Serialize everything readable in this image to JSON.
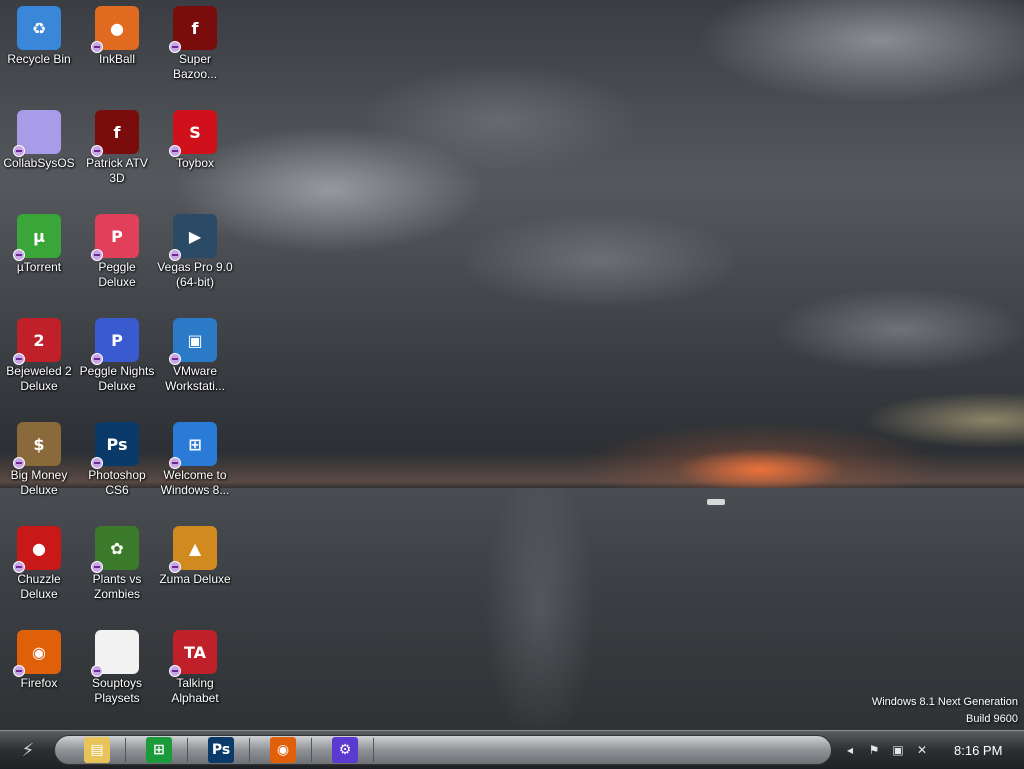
{
  "desktop": {
    "icons": [
      {
        "label": "Recycle Bin",
        "icon": "recycle-bin-icon",
        "glyph": "♻",
        "bg": "#3a86d8"
      },
      {
        "label": "InkBall",
        "icon": "inkball-icon",
        "glyph": "●",
        "bg": "#e06a20"
      },
      {
        "label": "Super Bazoo...",
        "icon": "flash-icon",
        "glyph": "f",
        "bg": "#7a0c0c"
      },
      {
        "label": "CollabSysOS",
        "icon": "collabsysos-icon",
        "glyph": "",
        "bg": "#a89ce8"
      },
      {
        "label": "Patrick ATV 3D",
        "icon": "flash-icon",
        "glyph": "f",
        "bg": "#7a0c0c"
      },
      {
        "label": "Toybox",
        "icon": "toybox-icon",
        "glyph": "S",
        "bg": "#d0101a"
      },
      {
        "label": "µTorrent",
        "icon": "utorrent-icon",
        "glyph": "µ",
        "bg": "#3aa63a"
      },
      {
        "label": "Peggle Deluxe",
        "icon": "peggle-icon",
        "glyph": "P",
        "bg": "#e0405a"
      },
      {
        "label": "Vegas Pro 9.0 (64-bit)",
        "icon": "vegas-pro-icon",
        "glyph": "▶",
        "bg": "#2a4a66"
      },
      {
        "label": "Bejeweled 2 Deluxe",
        "icon": "bejeweled-icon",
        "glyph": "2",
        "bg": "#c0202a"
      },
      {
        "label": "Peggle Nights Deluxe",
        "icon": "peggle-nights-icon",
        "glyph": "P",
        "bg": "#3a5ad0"
      },
      {
        "label": "VMware Workstati...",
        "icon": "vmware-icon",
        "glyph": "▣",
        "bg": "#2a7ac8"
      },
      {
        "label": "Big Money Deluxe",
        "icon": "money-bag-icon",
        "glyph": "$",
        "bg": "#8a6a3a"
      },
      {
        "label": "Photoshop CS6",
        "icon": "photoshop-icon",
        "glyph": "Ps",
        "bg": "#0a3a6a"
      },
      {
        "label": "Welcome to Windows 8...",
        "icon": "windows-logo-icon",
        "glyph": "⊞",
        "bg": "#2a7ad8"
      },
      {
        "label": "Chuzzle Deluxe",
        "icon": "chuzzle-icon",
        "glyph": "●",
        "bg": "#c81818"
      },
      {
        "label": "Plants vs Zombies",
        "icon": "plants-vs-zombies-icon",
        "glyph": "✿",
        "bg": "#3a7a2a"
      },
      {
        "label": "Zuma Deluxe",
        "icon": "zuma-icon",
        "glyph": "▲",
        "bg": "#d08a20"
      },
      {
        "label": "Firefox",
        "icon": "firefox-icon",
        "glyph": "◉",
        "bg": "#e0600a"
      },
      {
        "label": "Souptoys Playsets",
        "icon": "souptoys-icon",
        "glyph": "",
        "bg": "#f2f2f2"
      },
      {
        "label": "Talking Alphabet",
        "icon": "talking-alphabet-icon",
        "glyph": "TA",
        "bg": "#c0202a"
      }
    ]
  },
  "watermark": {
    "line1": "Windows 8.1 Next Generation",
    "line2": "Build 9600"
  },
  "taskbar": {
    "start_glyph": "⚡",
    "pinned": [
      {
        "name": "file-explorer",
        "icon": "folder-icon",
        "glyph": "▤",
        "bg": "#e8c35a"
      },
      {
        "name": "store",
        "icon": "store-icon",
        "glyph": "⊞",
        "bg": "#1a9a3a"
      },
      {
        "name": "photoshop",
        "icon": "photoshop-icon",
        "glyph": "Ps",
        "bg": "#0a3a6a"
      },
      {
        "name": "firefox",
        "icon": "firefox-icon",
        "glyph": "◉",
        "bg": "#e0600a"
      },
      {
        "name": "settings",
        "icon": "gear-icon",
        "glyph": "⚙",
        "bg": "#5a3ad0"
      }
    ],
    "tray": {
      "clock": "8:16 PM"
    }
  }
}
